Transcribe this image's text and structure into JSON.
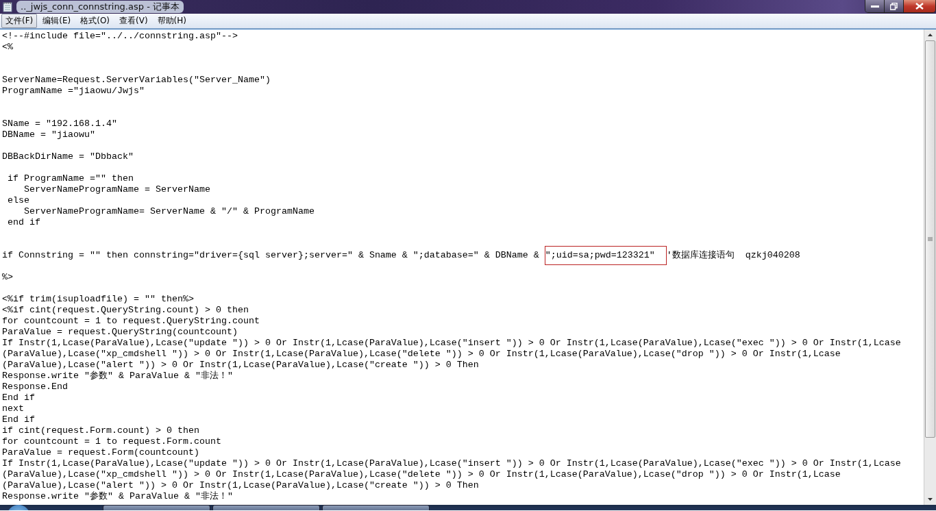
{
  "window": {
    "title": ".._jwjs_conn_connstring.asp - 记事本"
  },
  "menu": [
    {
      "label": "文件(F)",
      "selected": true
    },
    {
      "label": "编辑(E)",
      "selected": false
    },
    {
      "label": "格式(O)",
      "selected": false
    },
    {
      "label": "查看(V)",
      "selected": false
    },
    {
      "label": "帮助(H)",
      "selected": false
    }
  ],
  "lines": [
    {
      "kind": "text",
      "text": "<!--#include file=\"../../connstring.asp\"-->"
    },
    {
      "kind": "text",
      "text": "<%"
    },
    {
      "kind": "blank"
    },
    {
      "kind": "blank"
    },
    {
      "kind": "text",
      "text": "ServerName=Request.ServerVariables(\"Server_Name\")"
    },
    {
      "kind": "text",
      "text": "ProgramName =\"jiaowu/Jwjs\""
    },
    {
      "kind": "blank"
    },
    {
      "kind": "blank"
    },
    {
      "kind": "text",
      "text": "SName = \"192.168.1.4\""
    },
    {
      "kind": "text",
      "text": "DBName = \"jiaowu\""
    },
    {
      "kind": "blank"
    },
    {
      "kind": "text",
      "text": "DBBackDirName = \"Dbback\""
    },
    {
      "kind": "blank"
    },
    {
      "kind": "text",
      "text": " if ProgramName =\"\" then"
    },
    {
      "kind": "text",
      "text": "    ServerNameProgramName = ServerName"
    },
    {
      "kind": "text",
      "text": " else"
    },
    {
      "kind": "text",
      "text": "    ServerNameProgramName= ServerName & \"/\" & ProgramName"
    },
    {
      "kind": "text",
      "text": " end if"
    },
    {
      "kind": "blank"
    },
    {
      "kind": "blank"
    },
    {
      "kind": "segmented",
      "segments": [
        {
          "text": "if Connstring = \"\" then connstring=\"driver={sql server};server=\" & Sname & \";database=\" & DBName & ",
          "boxed": false
        },
        {
          "text": "\";uid=sa;pwd=123321\"  ",
          "boxed": true
        },
        {
          "text": "'数据库连接语句  qzkj040208",
          "boxed": false
        }
      ]
    },
    {
      "kind": "blank"
    },
    {
      "kind": "text",
      "text": "%>"
    },
    {
      "kind": "blank"
    },
    {
      "kind": "text",
      "text": "<%if trim(isuploadfile) = \"\" then%>"
    },
    {
      "kind": "text",
      "text": "<%if cint(request.QueryString.count) > 0 then"
    },
    {
      "kind": "text",
      "text": "for countcount = 1 to request.QueryString.count"
    },
    {
      "kind": "text",
      "text": "ParaValue = request.QueryString(countcount)"
    },
    {
      "kind": "text",
      "text": "If Instr(1,Lcase(ParaValue),Lcase(\"update \")) > 0 Or Instr(1,Lcase(ParaValue),Lcase(\"insert \")) > 0 Or Instr(1,Lcase(ParaValue),Lcase(\"exec \")) > 0 Or Instr(1,Lcase"
    },
    {
      "kind": "text",
      "text": "(ParaValue),Lcase(\"xp_cmdshell \")) > 0 Or Instr(1,Lcase(ParaValue),Lcase(\"delete \")) > 0 Or Instr(1,Lcase(ParaValue),Lcase(\"drop \")) > 0 Or Instr(1,Lcase"
    },
    {
      "kind": "text",
      "text": "(ParaValue),Lcase(\"alert \")) > 0 Or Instr(1,Lcase(ParaValue),Lcase(\"create \")) > 0 Then"
    },
    {
      "kind": "text",
      "text": "Response.write \"参数\" & ParaValue & \"非法！\""
    },
    {
      "kind": "text",
      "text": "Response.End"
    },
    {
      "kind": "text",
      "text": "End if"
    },
    {
      "kind": "text",
      "text": "next"
    },
    {
      "kind": "text",
      "text": "End if"
    },
    {
      "kind": "text",
      "text": "if cint(request.Form.count) > 0 then"
    },
    {
      "kind": "text",
      "text": "for countcount = 1 to request.Form.count"
    },
    {
      "kind": "text",
      "text": "ParaValue = request.Form(countcount)"
    },
    {
      "kind": "text",
      "text": "If Instr(1,Lcase(ParaValue),Lcase(\"update \")) > 0 Or Instr(1,Lcase(ParaValue),Lcase(\"insert \")) > 0 Or Instr(1,Lcase(ParaValue),Lcase(\"exec \")) > 0 Or Instr(1,Lcase"
    },
    {
      "kind": "text",
      "text": "(ParaValue),Lcase(\"xp_cmdshell \")) > 0 Or Instr(1,Lcase(ParaValue),Lcase(\"delete \")) > 0 Or Instr(1,Lcase(ParaValue),Lcase(\"drop \")) > 0 Or Instr(1,Lcase"
    },
    {
      "kind": "text",
      "text": "(ParaValue),Lcase(\"alert \")) > 0 Or Instr(1,Lcase(ParaValue),Lcase(\"create \")) > 0 Then"
    },
    {
      "kind": "text",
      "text": "Response.write \"参数\" & ParaValue & \"非法！\""
    }
  ]
}
